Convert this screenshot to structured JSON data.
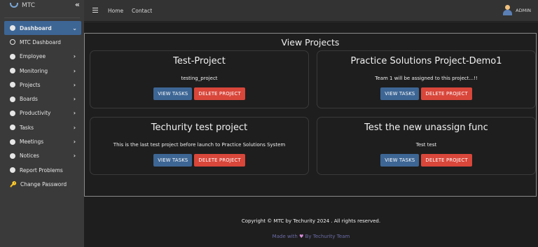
{
  "brand": {
    "name": "MTC"
  },
  "topbar": {
    "links": [
      "Home",
      "Contact"
    ],
    "user_label": "ADMIN"
  },
  "sidebar": {
    "items": [
      {
        "label": "Dashboard",
        "active": true,
        "has_children": true,
        "icon": "circle-icon"
      },
      {
        "label": "MTC Dashboard",
        "active": false,
        "has_children": false,
        "icon": "circle-outline-icon"
      },
      {
        "label": "Employee",
        "active": false,
        "has_children": true,
        "icon": "circle-icon"
      },
      {
        "label": "Monitoring",
        "active": false,
        "has_children": true,
        "icon": "circle-icon"
      },
      {
        "label": "Projects",
        "active": false,
        "has_children": true,
        "icon": "circle-icon"
      },
      {
        "label": "Boards",
        "active": false,
        "has_children": true,
        "icon": "circle-icon"
      },
      {
        "label": "Productivity",
        "active": false,
        "has_children": true,
        "icon": "circle-icon"
      },
      {
        "label": "Tasks",
        "active": false,
        "has_children": true,
        "icon": "circle-icon"
      },
      {
        "label": "Meetings",
        "active": false,
        "has_children": true,
        "icon": "circle-icon"
      },
      {
        "label": "Notices",
        "active": false,
        "has_children": true,
        "icon": "circle-icon"
      },
      {
        "label": "Report Problems",
        "active": false,
        "has_children": false,
        "icon": "circle-icon"
      },
      {
        "label": "Change Password",
        "active": false,
        "has_children": false,
        "icon": "key-icon"
      }
    ]
  },
  "main": {
    "title": "View Projects",
    "view_label": "VIEW TASKS",
    "delete_label": "DELETE PROJECT",
    "projects": [
      {
        "name": "Test-Project",
        "description": "testing_project"
      },
      {
        "name": "Practice Solutions Project-Demo1",
        "description": "Team 1 will be assigned to this project...!!"
      },
      {
        "name": "Techurity test project",
        "description": "This is the last test project before launch to Practice Solutions System"
      },
      {
        "name": "Test the new unassign func",
        "description": "Test test"
      }
    ]
  },
  "footer": {
    "copyright": "Copyright © MTC by Techurity 2024 . All rights reserved.",
    "made_prefix": "Made with",
    "made_suffix": "By Techurity Team"
  },
  "colors": {
    "accent": "#3d6695",
    "danger": "#d9463a",
    "sidebar_bg": "#3a3a3a",
    "main_bg": "#1e1e1e"
  }
}
